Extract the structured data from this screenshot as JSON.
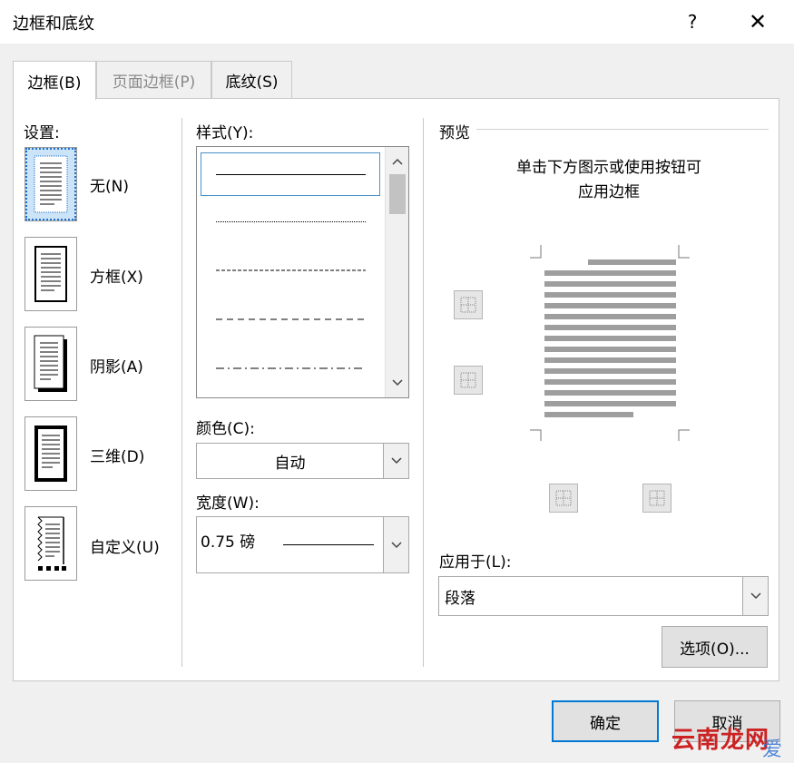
{
  "window": {
    "title": "边框和底纹",
    "help": "?",
    "close": "✕"
  },
  "tabs": [
    {
      "label": "边框(B)",
      "active": true
    },
    {
      "label": "页面边框(P)",
      "disabled": true
    },
    {
      "label": "底纹(S)"
    }
  ],
  "settings": {
    "label": "设置:",
    "items": [
      {
        "label": "无(N)",
        "selected": true
      },
      {
        "label": "方框(X)"
      },
      {
        "label": "阴影(A)"
      },
      {
        "label": "三维(D)"
      },
      {
        "label": "自定义(U)"
      }
    ]
  },
  "style": {
    "label": "样式(Y):",
    "items": [
      "solid",
      "dotted",
      "dashed-fine",
      "dashed",
      "dash-dot"
    ],
    "selected_index": 0
  },
  "color": {
    "label": "颜色(C):",
    "value": "自动"
  },
  "width": {
    "label": "宽度(W):",
    "value": "0.75 磅"
  },
  "preview": {
    "label": "预览",
    "hint_line1": "单击下方图示或使用按钮可",
    "hint_line2": "应用边框"
  },
  "apply_to": {
    "label": "应用于(L):",
    "value": "段落"
  },
  "buttons": {
    "options": "选项(O)...",
    "ok": "确定",
    "cancel": "取消"
  },
  "watermark": {
    "text": "云南龙网",
    "text2": "爱"
  }
}
